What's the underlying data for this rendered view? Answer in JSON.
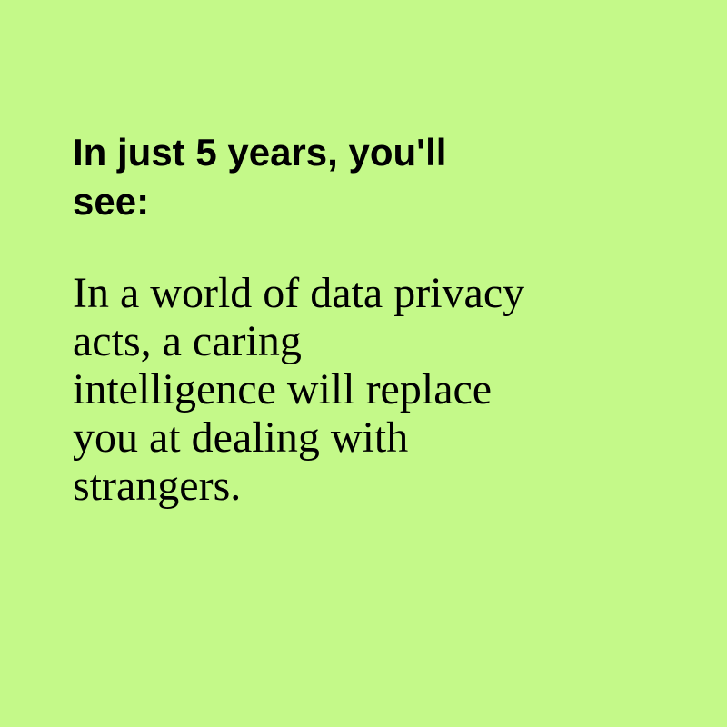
{
  "colors": {
    "background": "#c4f989",
    "text": "#000000"
  },
  "card": {
    "heading_lines": [
      "In just 5 years, you'll",
      "see:"
    ],
    "body_lines": [
      "In a world of data privacy",
      "acts, a caring",
      "intelligence will replace",
      "you at dealing with",
      "strangers."
    ]
  }
}
